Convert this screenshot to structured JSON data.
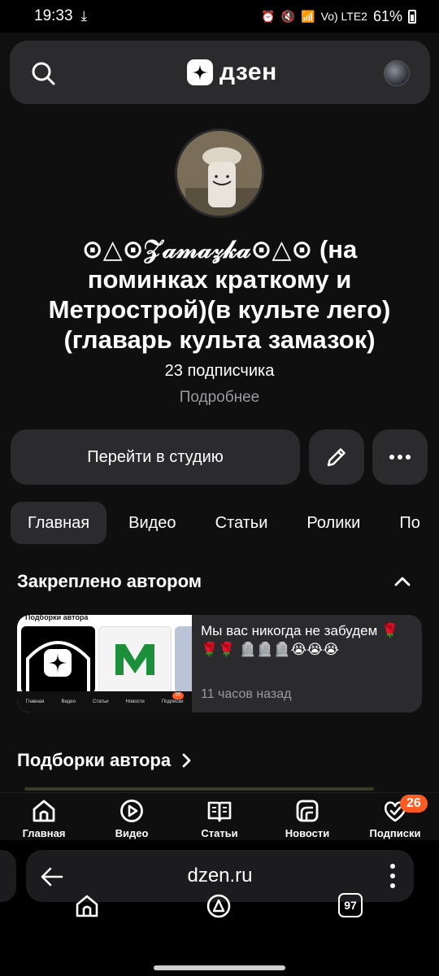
{
  "status_bar": {
    "time": "19:33",
    "network": "Vo) LTE2",
    "battery": "61%"
  },
  "header": {
    "logo_text": "дзен"
  },
  "profile": {
    "channel_name": "⊙△⊙𝒵𝒶𝓂𝒶𝓏𝓀𝒶⊙△⊙ (на поминках краткому и Метрострой)(в культе лего)(главарь культа замазок)",
    "subscribers": "23 подписчика",
    "more_link": "Подробнее"
  },
  "actions": {
    "studio_button": "Перейти в студию"
  },
  "tabs": [
    {
      "label": "Главная",
      "active": true
    },
    {
      "label": "Видео",
      "active": false
    },
    {
      "label": "Статьи",
      "active": false
    },
    {
      "label": "Ролики",
      "active": false
    },
    {
      "label": "По",
      "active": false
    }
  ],
  "pinned": {
    "heading": "Закреплено автором",
    "card": {
      "thumb_title": "Подборки автора",
      "thumb_nav": [
        "Главная",
        "Видео",
        "Статьи",
        "Новости",
        "Подписки"
      ],
      "thumb_badge": "26",
      "text": "Мы вас никогда не забудем 🌹🌹🌹 🪦🪦🪦😭😭😭",
      "time": "11 часов назад"
    }
  },
  "collections": {
    "heading": "Подборки автора"
  },
  "bottom_nav": {
    "items": [
      {
        "label": "Главная",
        "icon": "home-icon"
      },
      {
        "label": "Видео",
        "icon": "video-icon"
      },
      {
        "label": "Статьи",
        "icon": "articles-icon"
      },
      {
        "label": "Новости",
        "icon": "news-icon"
      },
      {
        "label": "Подписки",
        "icon": "subscriptions-icon"
      }
    ],
    "subscriptions_badge": "26"
  },
  "browser": {
    "url": "dzen.ru",
    "tab_count": "97"
  },
  "colors": {
    "background": "#0f0f10",
    "surface": "#2b2b2e",
    "accent_badge": "#ff5a1f",
    "muted_text": "#9a9a9f"
  }
}
